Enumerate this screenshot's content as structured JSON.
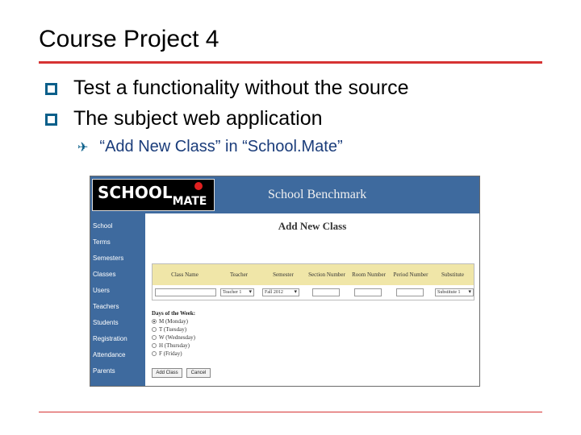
{
  "slide": {
    "title": "Course Project 4",
    "bullets": [
      "Test a functionality without the source",
      "The subject web application"
    ],
    "subbullet": "“Add New Class” in “School.Mate”"
  },
  "app": {
    "logo_school": "SCHOOL",
    "logo_mate": "MATE",
    "title": "School Benchmark",
    "page_heading": "Add New Class",
    "sidebar": [
      "School",
      "Terms",
      "Semesters",
      "Classes",
      "Users",
      "Teachers",
      "Students",
      "Registration",
      "Attendance",
      "Parents"
    ],
    "columns": [
      "Class Name",
      "Teacher",
      "Semester",
      "Section Number",
      "Room Number",
      "Period Number",
      "Substitute"
    ],
    "teacher_value": "Teacher 1",
    "semester_value": "Fall 2012",
    "substitute_value": "Substitute 1",
    "days_label": "Days of the Week:",
    "days": [
      "M (Monday)",
      "T (Tuesday)",
      "W (Wednesday)",
      "H (Thursday)",
      "F (Friday)"
    ],
    "selected_day_index": 0,
    "add_button": "Add Class",
    "cancel_button": "Cancel"
  },
  "colors": {
    "accent_red": "#d63333",
    "bullet_blue": "#0a5f8a",
    "app_blue": "#3e6a9e",
    "table_header": "#f0e6a8"
  }
}
